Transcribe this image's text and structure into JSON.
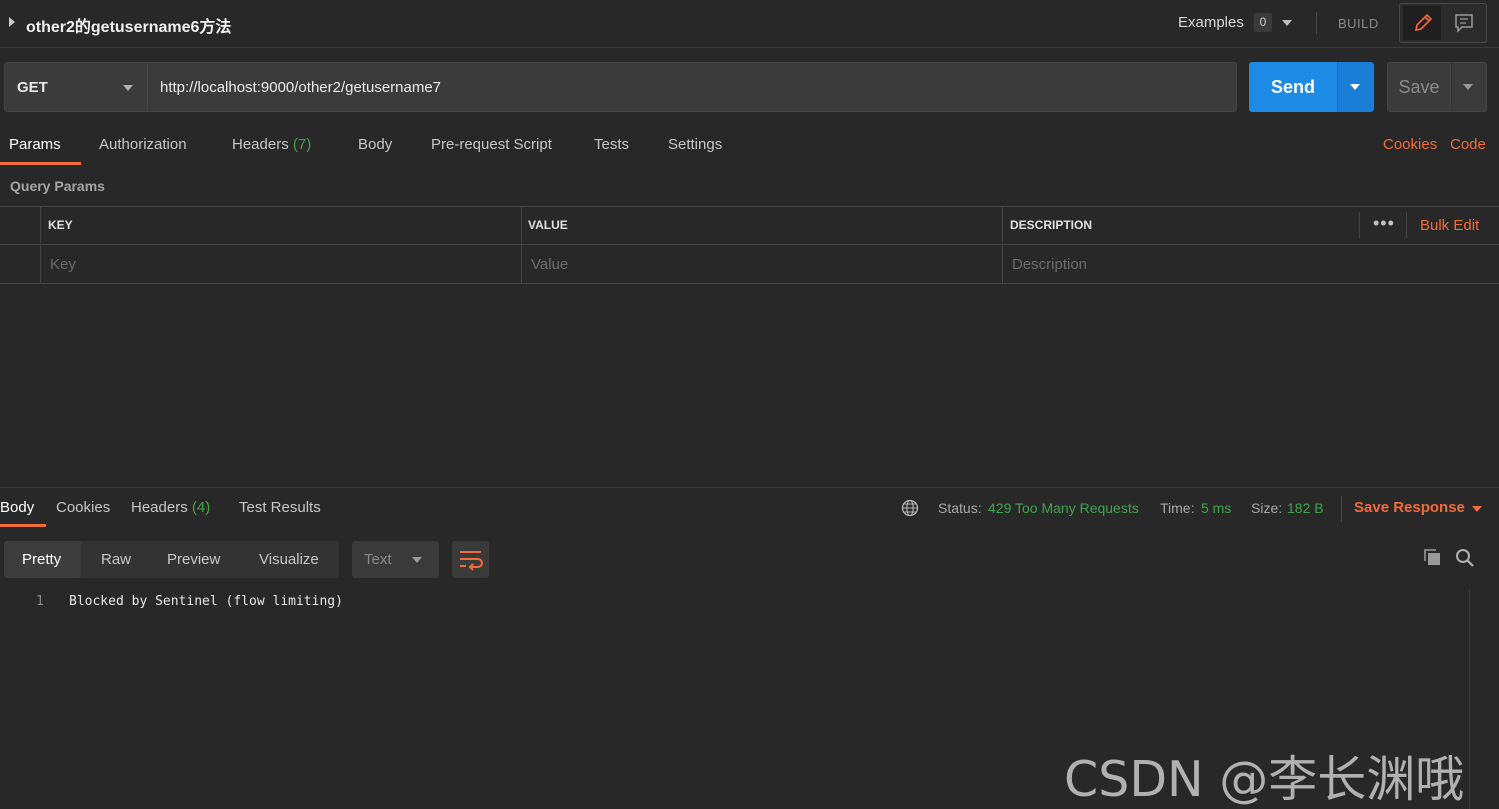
{
  "request": {
    "title": "other2的getusername6方法",
    "examples_label": "Examples",
    "examples_count": "0",
    "build_label": "BUILD",
    "method": "GET",
    "url": "http://localhost:9000/other2/getusername7",
    "send_label": "Send",
    "save_label": "Save"
  },
  "request_tabs": {
    "params": "Params",
    "authorization": "Authorization",
    "headers": "Headers",
    "headers_count": "(7)",
    "body": "Body",
    "pre_request": "Pre-request Script",
    "tests": "Tests",
    "settings": "Settings",
    "cookies": "Cookies",
    "code": "Code"
  },
  "query_params": {
    "title": "Query Params",
    "columns": [
      "KEY",
      "VALUE",
      "DESCRIPTION"
    ],
    "placeholders": [
      "Key",
      "Value",
      "Description"
    ],
    "more_label": "•••",
    "bulk_edit": "Bulk Edit"
  },
  "response_tabs": {
    "body": "Body",
    "cookies": "Cookies",
    "headers": "Headers",
    "headers_count": "(4)",
    "test_results": "Test Results"
  },
  "response_meta": {
    "status_label": "Status:",
    "status_value": "429 Too Many Requests",
    "time_label": "Time:",
    "time_value": "5 ms",
    "size_label": "Size:",
    "size_value": "182 B",
    "save_response": "Save Response"
  },
  "body_view": {
    "formats": [
      "Pretty",
      "Raw",
      "Preview",
      "Visualize"
    ],
    "language": "Text",
    "lines": [
      {
        "num": "1",
        "text": "Blocked by Sentinel (flow limiting)"
      }
    ]
  },
  "watermark": "CSDN @李长渊哦",
  "colors": {
    "accent": "#f26b3a",
    "send": "#1d8ae6",
    "success": "#3fa64a",
    "background": "#282828"
  }
}
